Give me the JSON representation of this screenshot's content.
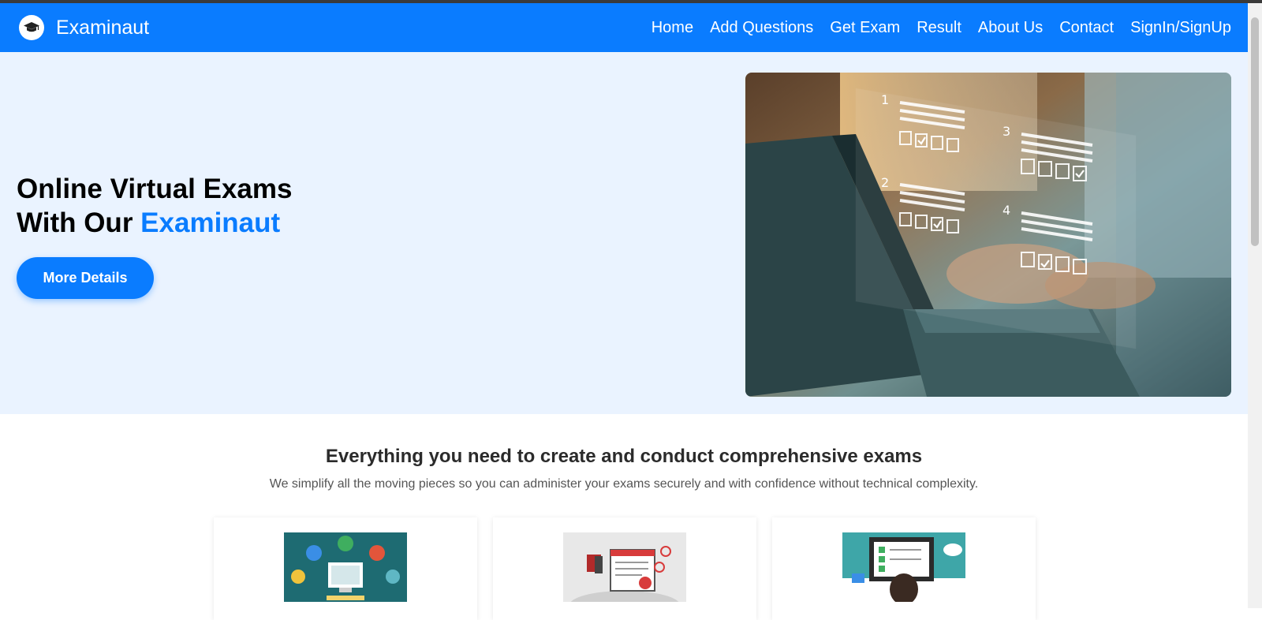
{
  "navbar": {
    "brand": "Examinaut",
    "links": [
      "Home",
      "Add Questions",
      "Get Exam",
      "Result",
      "About Us",
      "Contact",
      "SignIn/SignUp"
    ]
  },
  "hero": {
    "title_line1": "Online Virtual Exams",
    "title_line2_prefix": "With Our",
    "title_line2_accent": "Examinaut",
    "button": "More Details"
  },
  "features": {
    "title": "Everything you need to create and conduct comprehensive exams",
    "subtitle": "We simplify all the moving pieces so you can administer your exams securely and with confidence without technical complexity."
  },
  "colors": {
    "brand_blue": "#0a7cff",
    "hero_background": "#eaf3ff"
  }
}
